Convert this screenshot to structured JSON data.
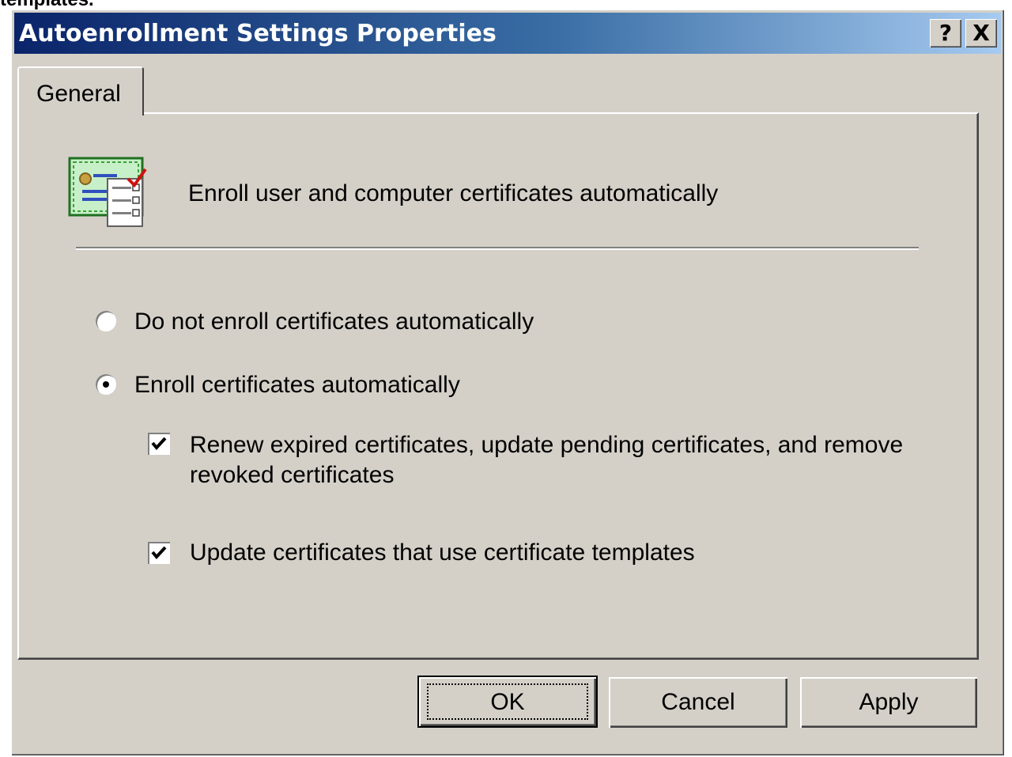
{
  "background_fragment": "templates.",
  "window": {
    "title": "Autoenrollment Settings Properties",
    "help_button": "?",
    "close_button": "X"
  },
  "tabs": [
    {
      "label": "General",
      "selected": true
    }
  ],
  "general": {
    "header_icon": "certificate-icon",
    "header_text": "Enroll user and computer certificates automatically",
    "options": {
      "do_not_enroll": {
        "label": "Do not enroll certificates automatically",
        "selected": false
      },
      "enroll": {
        "label": "Enroll certificates automatically",
        "selected": true
      }
    },
    "checkboxes": {
      "renew": {
        "label": "Renew expired certificates, update pending certificates, and remove revoked certificates",
        "checked": true
      },
      "update_templates": {
        "label": "Update certificates that use certificate templates",
        "checked": true
      }
    }
  },
  "buttons": {
    "ok": "OK",
    "cancel": "Cancel",
    "apply": "Apply"
  },
  "colors": {
    "face": "#d4d0c8",
    "title_start": "#0a246a",
    "title_end": "#a6caf0"
  }
}
